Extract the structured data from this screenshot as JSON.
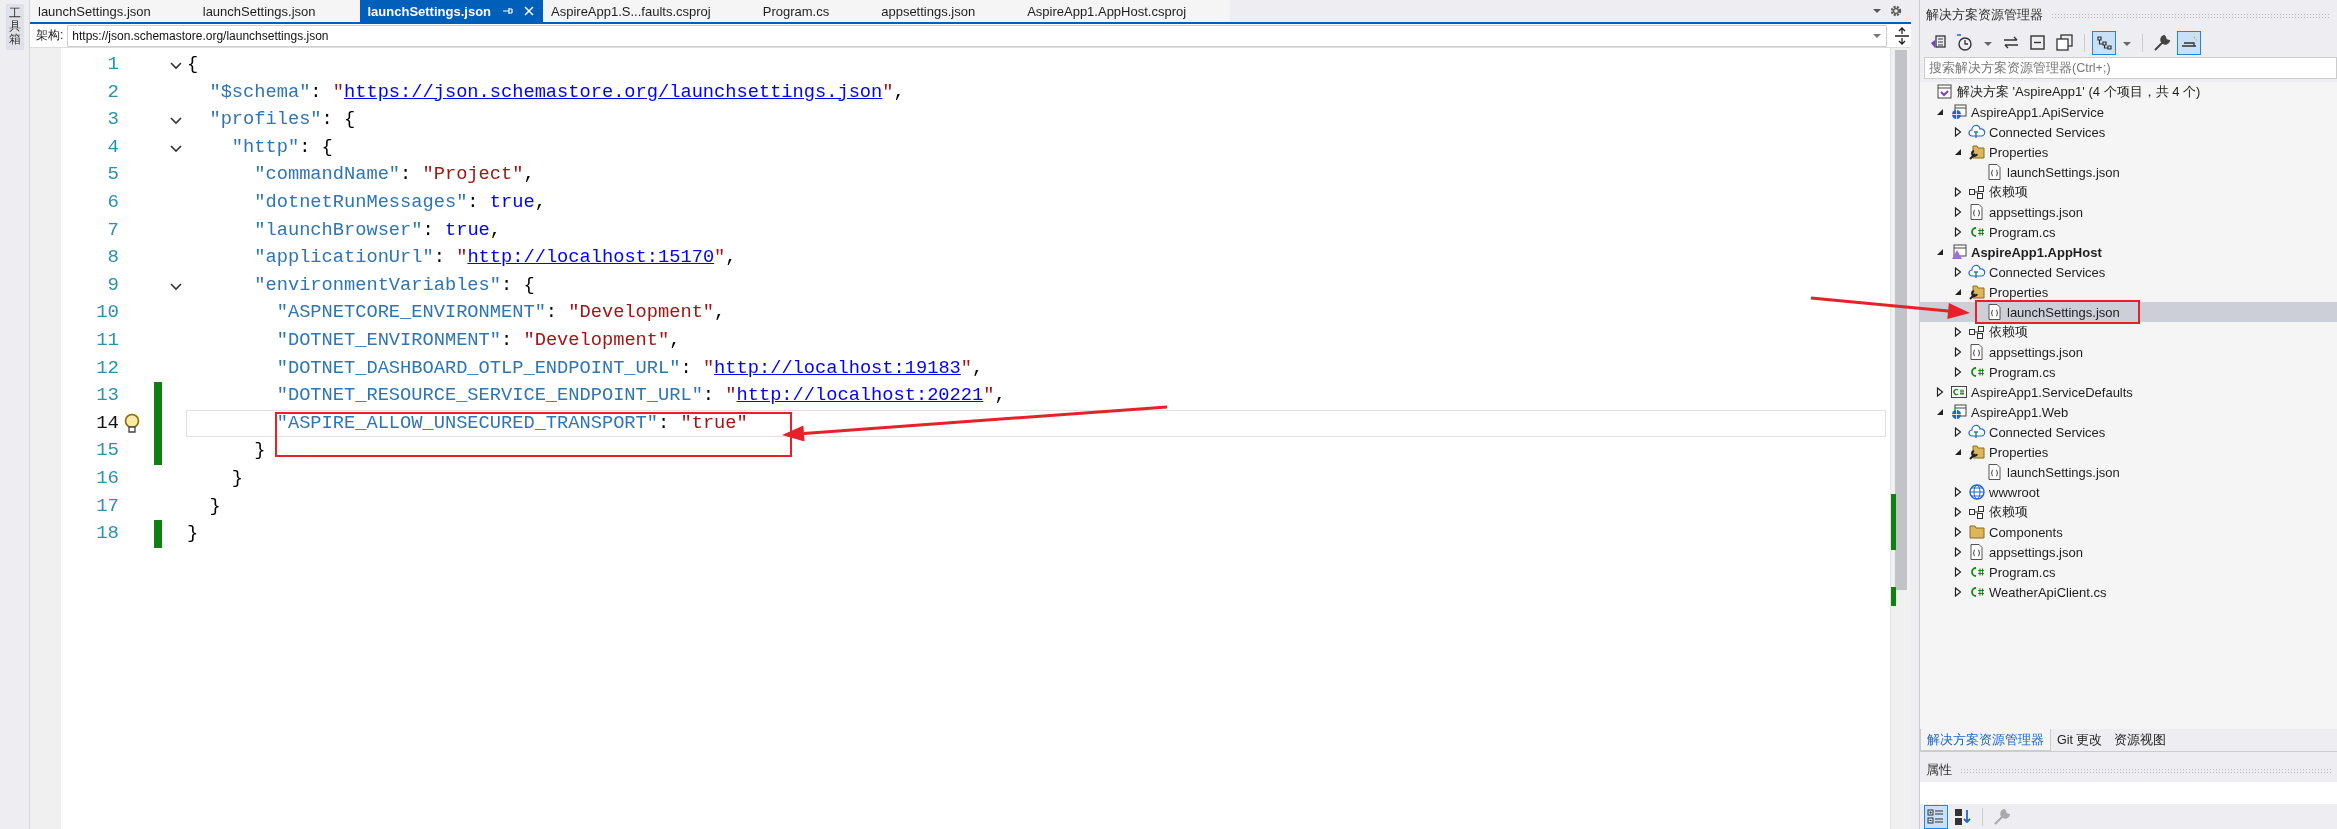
{
  "side_strip": {
    "label": "工具箱"
  },
  "tabs": [
    {
      "label": "launchSettings.json",
      "selected": false
    },
    {
      "label": "launchSettings.json",
      "selected": false
    },
    {
      "label": "launchSettings.json",
      "selected": true
    },
    {
      "label": "AspireApp1.S...faults.csproj",
      "selected": false
    },
    {
      "label": "Program.cs",
      "selected": false
    },
    {
      "label": "appsettings.json",
      "selected": false
    },
    {
      "label": "AspireApp1.AppHost.csproj",
      "selected": false
    }
  ],
  "schema_bar": {
    "label": "架构:",
    "value": "https://json.schemastore.org/launchsettings.json"
  },
  "editor": {
    "lines": [
      {
        "number": "1",
        "kind": "foldable",
        "expanded": true,
        "changed": false,
        "current": false,
        "lightbulb": false,
        "annotated": false,
        "tokens": [
          {
            "kind": "punct",
            "text": "{"
          }
        ]
      },
      {
        "number": "2",
        "kind": "plain",
        "changed": false,
        "current": false,
        "lightbulb": false,
        "annotated": false,
        "tokens": [
          {
            "kind": "key",
            "text": "  \"$schema\""
          },
          {
            "kind": "punct",
            "text": ": "
          },
          {
            "kind": "string",
            "text": "\""
          },
          {
            "kind": "link",
            "text": "https://json.schemastore.org/launchsettings.json"
          },
          {
            "kind": "string",
            "text": "\""
          },
          {
            "kind": "punct",
            "text": ","
          }
        ]
      },
      {
        "number": "3",
        "kind": "foldable",
        "expanded": true,
        "changed": false,
        "current": false,
        "lightbulb": false,
        "annotated": false,
        "tokens": [
          {
            "kind": "key",
            "text": "  \"profiles\""
          },
          {
            "kind": "punct",
            "text": ": {"
          }
        ]
      },
      {
        "number": "4",
        "kind": "foldable",
        "expanded": true,
        "changed": false,
        "current": false,
        "lightbulb": false,
        "annotated": false,
        "tokens": [
          {
            "kind": "key",
            "text": "    \"http\""
          },
          {
            "kind": "punct",
            "text": ": {"
          }
        ]
      },
      {
        "number": "5",
        "kind": "plain",
        "changed": false,
        "current": false,
        "lightbulb": false,
        "annotated": false,
        "tokens": [
          {
            "kind": "key",
            "text": "      \"commandName\""
          },
          {
            "kind": "punct",
            "text": ": "
          },
          {
            "kind": "string",
            "text": "\"Project\""
          },
          {
            "kind": "punct",
            "text": ","
          }
        ]
      },
      {
        "number": "6",
        "kind": "plain",
        "changed": false,
        "current": false,
        "lightbulb": false,
        "annotated": false,
        "tokens": [
          {
            "kind": "key",
            "text": "      \"dotnetRunMessages\""
          },
          {
            "kind": "punct",
            "text": ": "
          },
          {
            "kind": "keyword",
            "text": "true"
          },
          {
            "kind": "punct",
            "text": ","
          }
        ]
      },
      {
        "number": "7",
        "kind": "plain",
        "changed": false,
        "current": false,
        "lightbulb": false,
        "annotated": false,
        "tokens": [
          {
            "kind": "key",
            "text": "      \"launchBrowser\""
          },
          {
            "kind": "punct",
            "text": ": "
          },
          {
            "kind": "keyword",
            "text": "true"
          },
          {
            "kind": "punct",
            "text": ","
          }
        ]
      },
      {
        "number": "8",
        "kind": "plain",
        "changed": false,
        "current": false,
        "lightbulb": false,
        "annotated": false,
        "tokens": [
          {
            "kind": "key",
            "text": "      \"applicationUrl\""
          },
          {
            "kind": "punct",
            "text": ": "
          },
          {
            "kind": "string",
            "text": "\""
          },
          {
            "kind": "link",
            "text": "http://localhost:15170"
          },
          {
            "kind": "string",
            "text": "\""
          },
          {
            "kind": "punct",
            "text": ","
          }
        ]
      },
      {
        "number": "9",
        "kind": "foldable",
        "expanded": true,
        "changed": false,
        "current": false,
        "lightbulb": false,
        "annotated": false,
        "tokens": [
          {
            "kind": "key",
            "text": "      \"environmentVariables\""
          },
          {
            "kind": "punct",
            "text": ": {"
          }
        ]
      },
      {
        "number": "10",
        "kind": "plain",
        "changed": false,
        "current": false,
        "lightbulb": false,
        "annotated": false,
        "tokens": [
          {
            "kind": "key",
            "text": "        \"ASPNETCORE_ENVIRONMENT\""
          },
          {
            "kind": "punct",
            "text": ": "
          },
          {
            "kind": "string",
            "text": "\"Development\""
          },
          {
            "kind": "punct",
            "text": ","
          }
        ]
      },
      {
        "number": "11",
        "kind": "plain",
        "changed": false,
        "current": false,
        "lightbulb": false,
        "annotated": false,
        "tokens": [
          {
            "kind": "key",
            "text": "        \"DOTNET_ENVIRONMENT\""
          },
          {
            "kind": "punct",
            "text": ": "
          },
          {
            "kind": "string",
            "text": "\"Development\""
          },
          {
            "kind": "punct",
            "text": ","
          }
        ]
      },
      {
        "number": "12",
        "kind": "plain",
        "changed": false,
        "current": false,
        "lightbulb": false,
        "annotated": false,
        "tokens": [
          {
            "kind": "key",
            "text": "        \"DOTNET_DASHBOARD_OTLP_ENDPOINT_URL\""
          },
          {
            "kind": "punct",
            "text": ": "
          },
          {
            "kind": "string",
            "text": "\""
          },
          {
            "kind": "link",
            "text": "http://localhost:19183"
          },
          {
            "kind": "string",
            "text": "\""
          },
          {
            "kind": "punct",
            "text": ","
          }
        ]
      },
      {
        "number": "13",
        "kind": "plain",
        "changed": true,
        "current": false,
        "lightbulb": false,
        "annotated": false,
        "tokens": [
          {
            "kind": "key",
            "text": "        \"DOTNET_RESOURCE_SERVICE_ENDPOINT_URL\""
          },
          {
            "kind": "punct",
            "text": ": "
          },
          {
            "kind": "string",
            "text": "\""
          },
          {
            "kind": "link",
            "text": "http://localhost:20221"
          },
          {
            "kind": "string",
            "text": "\""
          },
          {
            "kind": "punct",
            "text": ","
          }
        ]
      },
      {
        "number": "14",
        "kind": "plain",
        "changed": true,
        "current": true,
        "lightbulb": true,
        "annotated": true,
        "tokens": [
          {
            "kind": "key",
            "text": "        \"ASPIRE_ALLOW_UNSECURED_TRANSPORT\""
          },
          {
            "kind": "punct",
            "text": ": "
          },
          {
            "kind": "string",
            "text": "\"true\""
          }
        ]
      },
      {
        "number": "15",
        "kind": "plain",
        "changed": true,
        "current": false,
        "lightbulb": false,
        "annotated": false,
        "tokens": [
          {
            "kind": "punct",
            "text": "      }"
          }
        ]
      },
      {
        "number": "16",
        "kind": "plain",
        "changed": false,
        "current": false,
        "lightbulb": false,
        "annotated": false,
        "tokens": [
          {
            "kind": "punct",
            "text": "    }"
          }
        ]
      },
      {
        "number": "17",
        "kind": "plain",
        "changed": false,
        "current": false,
        "lightbulb": false,
        "annotated": false,
        "tokens": [
          {
            "kind": "punct",
            "text": "  }"
          }
        ]
      },
      {
        "number": "18",
        "kind": "plain",
        "changed": true,
        "current": false,
        "lightbulb": false,
        "annotated": false,
        "tokens": [
          {
            "kind": "punct",
            "text": "}"
          }
        ]
      }
    ]
  },
  "solution_explorer": {
    "title": "解决方案资源管理器",
    "toolbar": [
      {
        "kind": "switch-views",
        "on": false
      },
      {
        "kind": "history",
        "on": false
      },
      {
        "kind": "caret",
        "on": false
      },
      {
        "kind": "sync",
        "on": false
      },
      {
        "kind": "collapse",
        "on": false
      },
      {
        "kind": "copies",
        "on": false
      },
      {
        "kind": "separator"
      },
      {
        "kind": "tree-filter",
        "on": true
      },
      {
        "kind": "caret",
        "on": false
      },
      {
        "kind": "separator"
      },
      {
        "kind": "wrench",
        "on": false
      },
      {
        "kind": "preview",
        "on": true
      }
    ],
    "search": {
      "placeholder": "搜索解决方案资源管理器(Ctrl+;)"
    },
    "tree": [
      {
        "label": "解决方案 'AspireApp1' (4 个项目，共 4 个)",
        "kind": "solution",
        "selected": false,
        "annotated": false,
        "children": [
          {
            "label": "AspireApp1.ApiService",
            "kind": "web-project",
            "expanded": true,
            "startup": false,
            "selected": false,
            "annotated": false,
            "children": [
              {
                "label": "Connected Services",
                "kind": "connected",
                "expanded": false,
                "selected": false,
                "annotated": false
              },
              {
                "label": "Properties",
                "kind": "properties",
                "expanded": true,
                "selected": false,
                "annotated": false,
                "children": [
                  {
                    "label": "launchSettings.json",
                    "kind": "json",
                    "selected": false,
                    "annotated": false
                  }
                ]
              },
              {
                "label": "依赖项",
                "kind": "deps",
                "expanded": false,
                "selected": false,
                "annotated": false
              },
              {
                "label": "appsettings.json",
                "kind": "json",
                "expanded": false,
                "selected": false,
                "annotated": false
              },
              {
                "label": "Program.cs",
                "kind": "cs",
                "expanded": false,
                "selected": false,
                "annotated": false
              }
            ]
          },
          {
            "label": "AspireApp1.AppHost",
            "kind": "apphost",
            "expanded": true,
            "startup": true,
            "selected": false,
            "annotated": false,
            "children": [
              {
                "label": "Connected Services",
                "kind": "connected",
                "expanded": false,
                "selected": false,
                "annotated": false
              },
              {
                "label": "Properties",
                "kind": "properties",
                "expanded": true,
                "selected": false,
                "annotated": false,
                "children": [
                  {
                    "label": "launchSettings.json",
                    "kind": "json",
                    "selected": true,
                    "annotated": true
                  }
                ]
              },
              {
                "label": "依赖项",
                "kind": "deps",
                "expanded": false,
                "selected": false,
                "annotated": false
              },
              {
                "label": "appsettings.json",
                "kind": "json",
                "expanded": false,
                "selected": false,
                "annotated": false
              },
              {
                "label": "Program.cs",
                "kind": "cs",
                "expanded": false,
                "selected": false,
                "annotated": false
              }
            ]
          },
          {
            "label": "AspireApp1.ServiceDefaults",
            "kind": "cs-project",
            "expanded": false,
            "startup": false,
            "selected": false,
            "annotated": false
          },
          {
            "label": "AspireApp1.Web",
            "kind": "web-project",
            "expanded": true,
            "startup": false,
            "selected": false,
            "annotated": false,
            "children": [
              {
                "label": "Connected Services",
                "kind": "connected",
                "expanded": false,
                "selected": false,
                "annotated": false
              },
              {
                "label": "Properties",
                "kind": "properties",
                "expanded": true,
                "selected": false,
                "annotated": false,
                "children": [
                  {
                    "label": "launchSettings.json",
                    "kind": "json",
                    "selected": false,
                    "annotated": false
                  }
                ]
              },
              {
                "label": "wwwroot",
                "kind": "globe",
                "expanded": false,
                "selected": false,
                "annotated": false
              },
              {
                "label": "依赖项",
                "kind": "deps",
                "expanded": false,
                "selected": false,
                "annotated": false
              },
              {
                "label": "Components",
                "kind": "folder",
                "expanded": false,
                "selected": false,
                "annotated": false
              },
              {
                "label": "appsettings.json",
                "kind": "json",
                "expanded": false,
                "selected": false,
                "annotated": false
              },
              {
                "label": "Program.cs",
                "kind": "cs",
                "expanded": false,
                "selected": false,
                "annotated": false
              },
              {
                "label": "WeatherApiClient.cs",
                "kind": "cs",
                "expanded": false,
                "selected": false,
                "annotated": false
              }
            ]
          }
        ]
      }
    ],
    "bottom_tabs": [
      {
        "label": "解决方案资源管理器",
        "selected": true
      },
      {
        "label": "Git 更改",
        "selected": false
      },
      {
        "label": "资源视图",
        "selected": false
      }
    ]
  },
  "properties_panel": {
    "title": "属性",
    "toolbar": [
      {
        "kind": "categorized",
        "on": true
      },
      {
        "kind": "alphabetical",
        "on": false
      },
      {
        "kind": "separator"
      },
      {
        "kind": "wrench",
        "on": false
      }
    ]
  }
}
